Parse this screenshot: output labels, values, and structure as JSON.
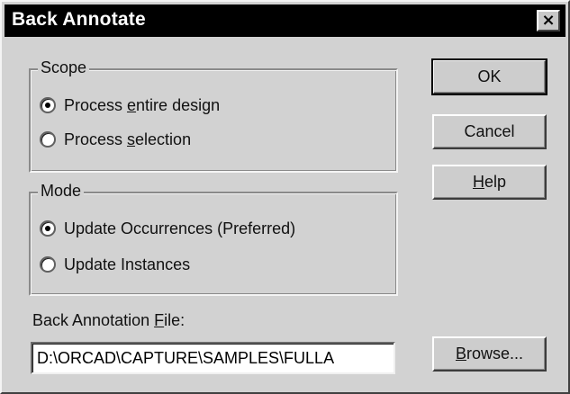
{
  "window": {
    "title": "Back Annotate",
    "close_glyph": "×"
  },
  "scope": {
    "label": "Scope",
    "options": [
      {
        "pre": "Process ",
        "key": "e",
        "post": "ntire design",
        "checked": true
      },
      {
        "pre": "Process ",
        "key": "s",
        "post": "election",
        "checked": false
      }
    ]
  },
  "mode": {
    "label": "Mode",
    "options": [
      {
        "pre": "Update Occurrences (Preferred)",
        "key": "",
        "post": "",
        "checked": true
      },
      {
        "pre": "Update Instances",
        "key": "",
        "post": "",
        "checked": false
      }
    ]
  },
  "buttons": {
    "ok": "OK",
    "cancel": "Cancel",
    "help": {
      "key": "H",
      "post": "elp"
    },
    "browse": {
      "key": "B",
      "post": "rowse..."
    }
  },
  "file": {
    "label_pre": "Back Annotation ",
    "label_key": "F",
    "label_post": "ile:",
    "value": "D:\\ORCAD\\CAPTURE\\SAMPLES\\FULLA"
  },
  "icons": {
    "close": "close-icon",
    "radio_checked": "radio-checked-icon",
    "radio_unchecked": "radio-unchecked-icon"
  }
}
